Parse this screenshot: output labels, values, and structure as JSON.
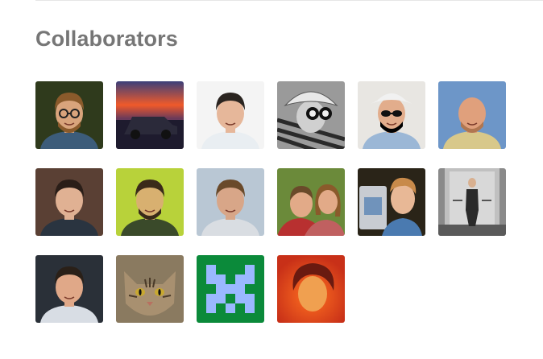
{
  "section": {
    "title": "Collaborators"
  },
  "collaborators": [
    {
      "avatar": "bearded-man-glasses",
      "colors": {
        "bg": "#2f3a1c",
        "skin": "#d9a47c",
        "hair": "#8a5a2b",
        "shirt": "#3c5c7a"
      }
    },
    {
      "avatar": "car-at-sunset",
      "colors": {
        "sky": "#f05a2a",
        "sky2": "#3b3f7a",
        "ground": "#1e1b2e",
        "car": "#2b2a3a"
      }
    },
    {
      "avatar": "smiling-man",
      "colors": {
        "bg": "#f4f4f4",
        "skin": "#e6b79a",
        "hair": "#2a2420",
        "shirt": "#e9eef2"
      }
    },
    {
      "avatar": "person-with-sunglasses-bw",
      "colors": {
        "bg": "#9a9a9a",
        "hat": "#e8e8e8",
        "skin": "#d0d0d0",
        "stripe": "#2a2a2a"
      }
    },
    {
      "avatar": "man-in-hat-sunglasses",
      "colors": {
        "bg": "#e8e6e2",
        "hat": "#f1f1f1",
        "skin": "#e2ad8c",
        "shirt": "#9bb7d6"
      }
    },
    {
      "avatar": "bald-man-sky",
      "colors": {
        "bg": "#6d96c8",
        "skin": "#e0a07c",
        "beard": "#b07650",
        "shirt": "#d8c88a"
      }
    },
    {
      "avatar": "man-brick-wall",
      "colors": {
        "bg": "#5a4034",
        "skin": "#e0b193",
        "hair": "#2a1e18",
        "shirt": "#2a3440"
      }
    },
    {
      "avatar": "man-green-light",
      "colors": {
        "bg": "#b8d23a",
        "skin": "#d8b070",
        "hair": "#3a2a1a",
        "shirt": "#3a4a2a"
      }
    },
    {
      "avatar": "man-outdoors",
      "colors": {
        "bg": "#b9c7d4",
        "skin": "#d8a688",
        "hair": "#6a4a2a",
        "shirt": "#d9dde2"
      }
    },
    {
      "avatar": "couple-selfie",
      "colors": {
        "bg": "#6b8a3a",
        "skin": "#e2aa88",
        "hair": "#8a5a2b",
        "shirt": "#b83030"
      }
    },
    {
      "avatar": "man-with-laptop",
      "colors": {
        "bg": "#2a2418",
        "skin": "#e8b896",
        "hair": "#c88a4a",
        "shirt": "#4a7ab0"
      }
    },
    {
      "avatar": "person-in-elevator",
      "colors": {
        "bg": "#8a8a8a",
        "wall": "#c0c0c0",
        "figure": "#2a2a2a",
        "floor": "#5a5a5a"
      }
    },
    {
      "avatar": "speaker-on-stage",
      "colors": {
        "bg": "#2a3038",
        "skin": "#e0a888",
        "hair": "#2a2018",
        "shirt": "#d8dde4"
      }
    },
    {
      "avatar": "tabby-cat",
      "colors": {
        "bg": "#8a7a60",
        "fur": "#a89070",
        "stripe": "#4a3a28",
        "eye": "#c8a830"
      }
    },
    {
      "avatar": "pixel-identicon",
      "colors": {
        "bg": "#0b8a3a",
        "fg": "#9ab8ff"
      }
    },
    {
      "avatar": "man-red-lighting",
      "colors": {
        "bg": "#c83018",
        "skin": "#f0a050",
        "hair": "#6a1a10",
        "glow": "#ff7020"
      }
    }
  ]
}
